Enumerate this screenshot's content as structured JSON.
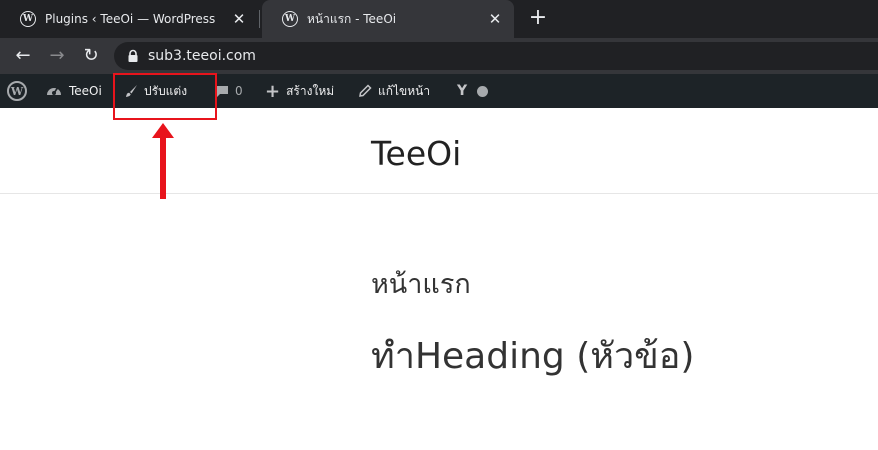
{
  "browser": {
    "tabs": [
      {
        "title": "Plugins ‹ TeeOi — WordPress",
        "active": false
      },
      {
        "title": "หน้าแรก - TeeOi",
        "active": true
      }
    ],
    "new_tab_icon": "plus-icon",
    "url": "sub3.teeoi.com"
  },
  "admin_bar": {
    "site_name": "TeeOi",
    "customize": "ปรับแต่ง",
    "comments_count": "0",
    "new": "สร้างใหม่",
    "edit_page": "แก้ไขหน้า",
    "yoast_letter": "Y"
  },
  "page": {
    "site_title": "TeeOi",
    "page_title": "หน้าแรก",
    "heading": "ทำHeading (หัวข้อ)"
  },
  "annotation": {
    "color": "#e8141c"
  }
}
